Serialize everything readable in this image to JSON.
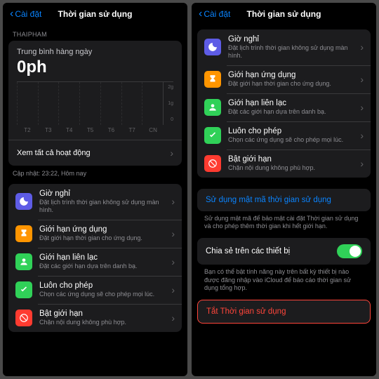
{
  "left": {
    "back_label": "Cài đặt",
    "title": "Thời gian sử dụng",
    "section_user": "THAIPHAM",
    "avg_label": "Trung bình hàng ngày",
    "avg_value": "0ph",
    "ylabels": [
      "2g",
      "1g",
      "0"
    ],
    "xlabels": [
      "T2",
      "T3",
      "T4",
      "T5",
      "T6",
      "T7",
      "CN"
    ],
    "see_all": "Xem tất cả hoạt động",
    "updated": "Cập nhật: 23:22, Hôm nay",
    "items": [
      {
        "title": "Giờ nghỉ",
        "sub": "Đặt lịch trình thời gian không sử dụng màn hình."
      },
      {
        "title": "Giới hạn ứng dụng",
        "sub": "Đặt giới hạn thời gian cho ứng dụng."
      },
      {
        "title": "Giới hạn liên lạc",
        "sub": "Đặt các giới hạn dựa trên danh bạ."
      },
      {
        "title": "Luôn cho phép",
        "sub": "Chọn các ứng dụng sẽ cho phép mọi lúc."
      },
      {
        "title": "Bật giới hạn",
        "sub": "Chặn nội dung không phù hợp."
      }
    ]
  },
  "right": {
    "back_label": "Cài đặt",
    "title": "Thời gian sử dụng",
    "items": [
      {
        "title": "Giờ nghỉ",
        "sub": "Đặt lịch trình thời gian không sử dụng màn hình."
      },
      {
        "title": "Giới hạn ứng dụng",
        "sub": "Đặt giới hạn thời gian cho ứng dụng."
      },
      {
        "title": "Giới hạn liên lạc",
        "sub": "Đặt các giới hạn dựa trên danh bạ."
      },
      {
        "title": "Luôn cho phép",
        "sub": "Chọn các ứng dụng sẽ cho phép mọi lúc."
      },
      {
        "title": "Bật giới hạn",
        "sub": "Chặn nội dung không phù hợp."
      }
    ],
    "passcode_link": "Sử dụng mật mã thời gian sử dụng",
    "passcode_sub": "Sử dụng mật mã để bảo mật cài đặt Thời gian sử dụng và cho phép thêm thời gian khi hết giới hạn.",
    "share_label": "Chia sẻ trên các thiết bị",
    "share_sub": "Bạn có thể bật tính năng này trên bất kỳ thiết bị nào được đăng nhập vào iCloud để báo cáo thời gian sử dụng tổng hợp.",
    "turn_off": "Tắt Thời gian sử dụng"
  },
  "chart_data": {
    "type": "bar",
    "categories": [
      "T2",
      "T3",
      "T4",
      "T5",
      "T6",
      "T7",
      "CN"
    ],
    "values": [
      0,
      0,
      0,
      0,
      0,
      0,
      0
    ],
    "title": "Trung bình hàng ngày",
    "xlabel": "",
    "ylabel": "giờ",
    "ylim": [
      0,
      2
    ]
  }
}
